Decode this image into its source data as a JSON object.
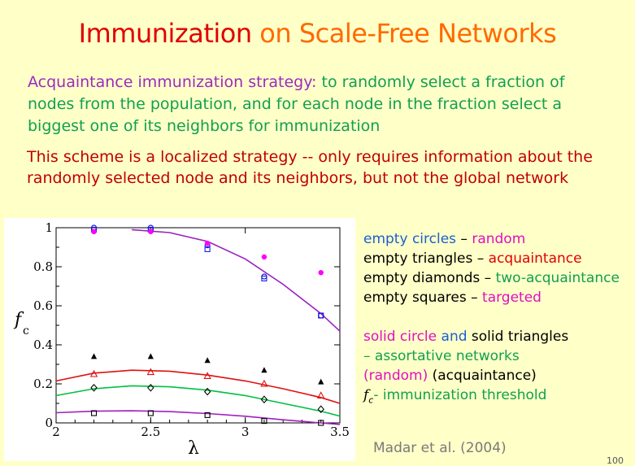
{
  "slide": {
    "title_part1": "Immunization",
    "title_part2": " on Scale-Free Networks",
    "para1_lead": "Acquaintance immunization strategy:",
    "para1_rest": " to randomly select a fraction of nodes from the population, and for each node in the fraction select a biggest one of its neighbors for immunization",
    "para2": "This scheme is a localized strategy -- only requires information about the randomly selected node and its neighbors, but not the global network",
    "citation": "Madar et al. (2004)",
    "page_number": "100"
  },
  "legend": {
    "line1_a": "empty circles",
    "line1_b": " – ",
    "line1_c": "random",
    "line2_a": "empty triangles",
    "line2_b": " – ",
    "line2_c": "acquaintance",
    "line3_a": "empty diamonds",
    "line3_b": " – ",
    "line3_c": "two-acquaintance",
    "line4_a": "empty squares",
    "line4_b": " – ",
    "line4_c": "targeted",
    "line5_a": "solid circle",
    "line5_b": " and ",
    "line5_c": "solid triangles",
    "line6": "– assortative networks",
    "line7_a": "(random)",
    "line7_b": "   (acquaintance)",
    "line8_a": "f",
    "line8_b": "c",
    "line8_c": "- immunization threshold"
  },
  "colors": {
    "random": "#1a1ae0",
    "acquaintance": "#e01010",
    "two_acquaintance": "#00c040",
    "targeted": "#a020c0",
    "solid_random": "#ff00ff",
    "solid_acquaintance": "#000000"
  },
  "chart_data": {
    "type": "scatter",
    "xlabel": "λ",
    "ylabel": "f",
    "ylabel_sub": "c",
    "xlim": [
      2,
      3.5
    ],
    "ylim": [
      0,
      1
    ],
    "xticks": [
      2,
      2.5,
      3,
      3.5
    ],
    "xtick_labels": [
      "2",
      "2.5",
      "3",
      "3.5"
    ],
    "yticks": [
      0,
      0.2,
      0.4,
      0.6,
      0.8,
      1
    ],
    "ytick_labels": [
      "0",
      "0.2",
      "0.4",
      "0.6",
      "0.8",
      "1"
    ],
    "grid": false,
    "series": [
      {
        "name": "random",
        "marker": "circle-open",
        "color": "#1a1ae0",
        "x": [
          2.2,
          2.5,
          2.8,
          3.1,
          3.4
        ],
        "y": [
          1.0,
          1.0,
          0.91,
          0.75,
          0.55
        ]
      },
      {
        "name": "targeted",
        "marker": "square-open",
        "color": "#1a1ae0",
        "x": [
          2.2,
          2.5,
          2.8,
          3.1,
          3.4
        ],
        "y": [
          0.99,
          0.99,
          0.89,
          0.74,
          0.55
        ]
      },
      {
        "name": "acquaintance",
        "marker": "triangle-open",
        "color": "#e01010",
        "x": [
          2.2,
          2.5,
          2.8,
          3.1,
          3.4
        ],
        "y": [
          0.25,
          0.26,
          0.24,
          0.2,
          0.14
        ]
      },
      {
        "name": "two-acquaintance",
        "marker": "diamond-open",
        "color": "#000000",
        "x": [
          2.2,
          2.5,
          2.8,
          3.1,
          3.4
        ],
        "y": [
          0.18,
          0.18,
          0.16,
          0.12,
          0.07
        ]
      },
      {
        "name": "targeted",
        "marker": "square-open",
        "color": "#000000",
        "x": [
          2.2,
          2.5,
          2.8,
          3.1,
          3.4
        ],
        "y": [
          0.05,
          0.05,
          0.04,
          0.01,
          0.0
        ]
      },
      {
        "name": "assortative random",
        "marker": "circle-solid",
        "color": "#ff00ff",
        "x": [
          2.2,
          2.5,
          2.8,
          3.1,
          3.4
        ],
        "y": [
          0.98,
          0.98,
          0.92,
          0.85,
          0.77
        ]
      },
      {
        "name": "assortative acquaintance",
        "marker": "triangle-solid",
        "color": "#000000",
        "x": [
          2.2,
          2.5,
          2.8,
          3.1,
          3.4
        ],
        "y": [
          0.34,
          0.34,
          0.32,
          0.27,
          0.21
        ]
      }
    ],
    "fit_curves": [
      {
        "name": "random fit",
        "color": "#9a20c0",
        "x": [
          2.4,
          2.6,
          2.8,
          3.0,
          3.2,
          3.4,
          3.5
        ],
        "y": [
          0.99,
          0.975,
          0.93,
          0.84,
          0.71,
          0.56,
          0.47
        ]
      },
      {
        "name": "acquaintance fit",
        "color": "#e01010",
        "x": [
          2.0,
          2.2,
          2.4,
          2.6,
          2.8,
          3.0,
          3.2,
          3.4,
          3.5
        ],
        "y": [
          0.215,
          0.255,
          0.27,
          0.265,
          0.245,
          0.215,
          0.175,
          0.13,
          0.1
        ]
      },
      {
        "name": "two-acquaintance fit",
        "color": "#00c040",
        "x": [
          2.0,
          2.2,
          2.4,
          2.6,
          2.8,
          3.0,
          3.2,
          3.4,
          3.5
        ],
        "y": [
          0.14,
          0.175,
          0.19,
          0.185,
          0.168,
          0.14,
          0.1,
          0.06,
          0.035
        ]
      },
      {
        "name": "targeted fit",
        "color": "#a020c0",
        "x": [
          2.0,
          2.2,
          2.4,
          2.6,
          2.8,
          3.0,
          3.2,
          3.4,
          3.5
        ],
        "y": [
          0.052,
          0.06,
          0.062,
          0.058,
          0.048,
          0.034,
          0.016,
          0.0,
          -0.008
        ]
      }
    ]
  }
}
